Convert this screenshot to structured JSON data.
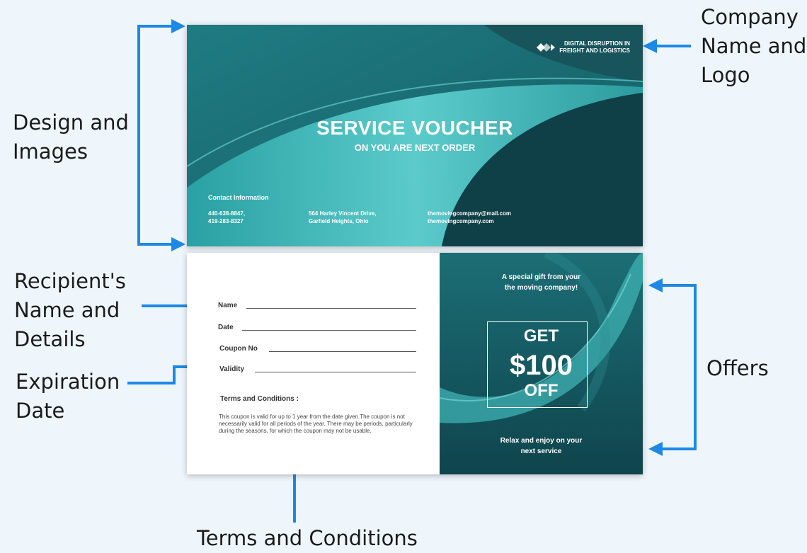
{
  "annotations": {
    "company": "Company Name and Logo",
    "design": "Design and Images",
    "recipient": "Recipient's Name and Details",
    "expiration": "Expiration Date",
    "offers": "Offers",
    "terms": "Terms and Conditions"
  },
  "front": {
    "logo_line1": "DIGITAL DISRUPTION IN",
    "logo_line2": "FREIGHT AND LOGISTICS",
    "title": "SERVICE VOUCHER",
    "subtitle": "ON YOU ARE NEXT ORDER",
    "contact_heading": "Contact Information",
    "phone1": "440-638-8847,",
    "phone2": "419-283-8327",
    "address1": "564 Harley Vincent Drive,",
    "address2": "Garfield Heights, Ohio",
    "email": "themovingcompany@mail.com",
    "website": "themovingcompany.com"
  },
  "back": {
    "fields": [
      "Name",
      "Date",
      "Coupon No",
      "Validity"
    ],
    "terms_heading": "Terms and Conditions :",
    "terms_body": "This coupon is valid for up to 1 year from the date given.The coupon is not necessarily valid for all periods of the year. There may be periods, particularly during the seasons, for which the coupon may not be usable.",
    "gift_line1": "A special gift from your",
    "gift_line2": "the moving company!",
    "offer_get": "GET",
    "offer_amount": "$100",
    "offer_off": "OFF",
    "relax_line1": "Relax and enjoy on your",
    "relax_line2": "next service"
  },
  "colors": {
    "teal_dark": "#124a52",
    "teal_mid": "#2a8a8e",
    "teal_light": "#4fc3c3",
    "arrow_blue": "#1e88e5"
  }
}
